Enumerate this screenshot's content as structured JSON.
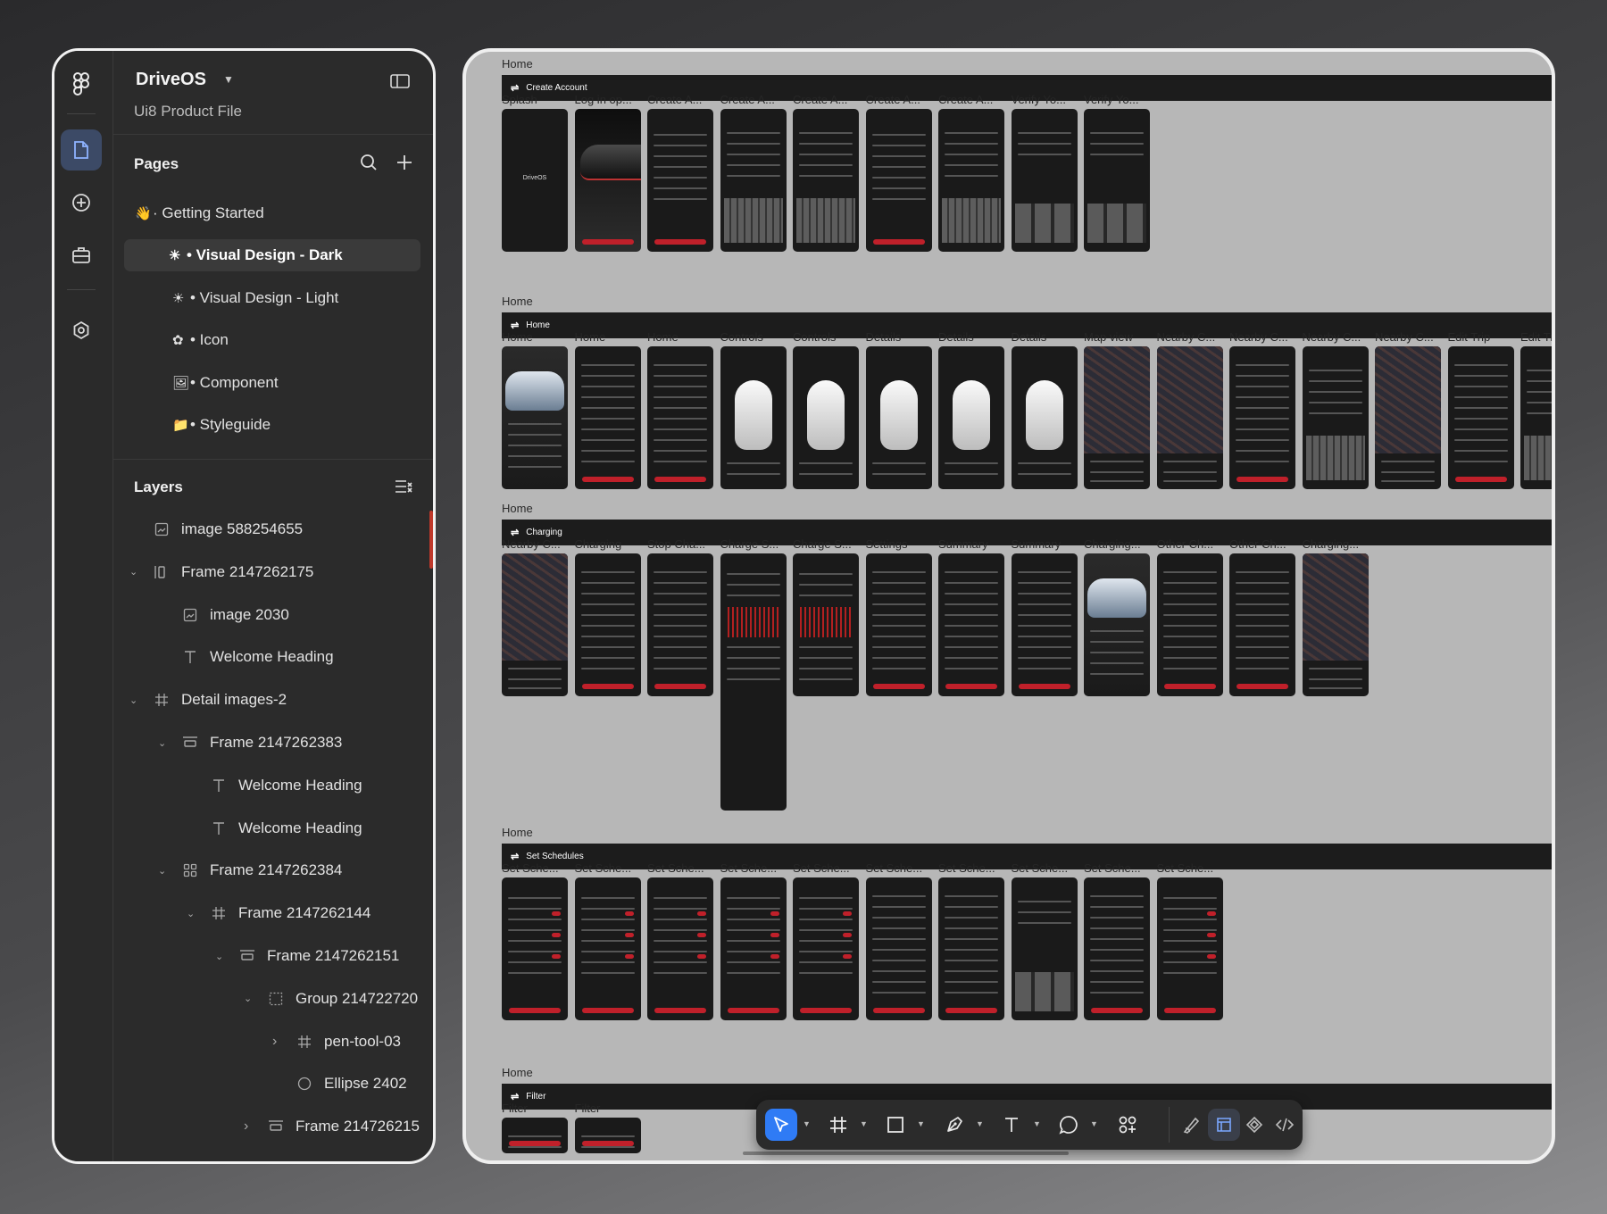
{
  "file": {
    "name": "DriveOS",
    "subtitle": "Ui8 Product File"
  },
  "pages": {
    "title": "Pages",
    "items": [
      {
        "emoji": "👋",
        "label": "· Getting Started",
        "active": false
      },
      {
        "emoji": "☀",
        "label": "• Visual Design - Dark",
        "active": true
      },
      {
        "emoji": "☀",
        "label": "• Visual Design - Light",
        "active": false
      },
      {
        "emoji": "✿",
        "label": "• Icon",
        "active": false
      },
      {
        "emoji": "🖼",
        "label": "• Component",
        "active": false
      },
      {
        "emoji": "📁",
        "label": "• Styleguide",
        "active": false
      }
    ]
  },
  "layers": {
    "title": "Layers",
    "items": [
      {
        "label": "image 588254655",
        "icon": "image-icon",
        "depth": 0,
        "chevron": ""
      },
      {
        "label": "Frame 2147262175",
        "icon": "frame-column-icon",
        "depth": 0,
        "chevron": "down"
      },
      {
        "label": "image 2030",
        "icon": "image-icon",
        "depth": 1,
        "chevron": ""
      },
      {
        "label": "Welcome Heading",
        "icon": "text-icon",
        "depth": 1,
        "chevron": ""
      },
      {
        "label": "Detail images-2",
        "icon": "frame-icon",
        "depth": 0,
        "chevron": "down"
      },
      {
        "label": "Frame 2147262383",
        "icon": "frame-row-icon",
        "depth": 1,
        "chevron": "down"
      },
      {
        "label": "Welcome Heading",
        "icon": "text-icon",
        "depth": 2,
        "chevron": ""
      },
      {
        "label": "Welcome Heading",
        "icon": "text-icon",
        "depth": 2,
        "chevron": ""
      },
      {
        "label": "Frame 2147262384",
        "icon": "frame-grid-icon",
        "depth": 1,
        "chevron": "down"
      },
      {
        "label": "Frame 2147262144",
        "icon": "frame-icon",
        "depth": 2,
        "chevron": "down"
      },
      {
        "label": "Frame 2147262151",
        "icon": "frame-row-icon",
        "depth": 3,
        "chevron": "down"
      },
      {
        "label": "Group 214722720",
        "icon": "group-icon",
        "depth": 4,
        "chevron": "down"
      },
      {
        "label": "pen-tool-03",
        "icon": "frame-icon",
        "depth": 5,
        "chevron": "right"
      },
      {
        "label": "Ellipse 2402",
        "icon": "ellipse-icon",
        "depth": 5,
        "chevron": ""
      },
      {
        "label": "Frame 214726215",
        "icon": "frame-row-icon",
        "depth": 4,
        "chevron": "right"
      }
    ]
  },
  "canvas": {
    "sections": [
      {
        "top_label": "Home",
        "bar": "Create Account",
        "screens": [
          "Splash",
          "Log in op...",
          "Create A...",
          "Create A...",
          "Create A...",
          "Create A...",
          "Create A...",
          "Verify Yo...",
          "Verify Yo..."
        ],
        "kinds": [
          "splash",
          "car-dark",
          "form",
          "keyboard",
          "keyboard",
          "form",
          "keyboard",
          "keypad",
          "keypad"
        ]
      },
      {
        "top_label": "Home",
        "bar": "Home",
        "screens": [
          "Home",
          "Home",
          "Home",
          "Controls",
          "Controls",
          "Details",
          "Details",
          "Details",
          "Map view",
          "Nearby C...",
          "Nearby C...",
          "Nearby C...",
          "Nearby C...",
          "Edit Trip",
          "Edit Tr"
        ],
        "kinds": [
          "car-side",
          "list",
          "list",
          "car-top",
          "car-top",
          "car-top",
          "car-top",
          "car-top",
          "map",
          "map",
          "list",
          "keyboard",
          "map",
          "list",
          "keyboard"
        ]
      },
      {
        "top_label": "Home",
        "bar": "Charging",
        "screens": [
          "Nearby C...",
          "Charging",
          "Stop Cha...",
          "Charge S...",
          "Charge S...",
          "Settings",
          "Summary",
          "Summary",
          "Charging...",
          "Other Ch...",
          "Other Ch...",
          "Charging..."
        ],
        "kinds": [
          "map",
          "list",
          "list",
          "chart",
          "chart",
          "list",
          "list",
          "list",
          "car-side",
          "list",
          "list",
          "map"
        ]
      },
      {
        "top_label": "Home",
        "bar": "Set Schedules",
        "screens": [
          "Set Sche...",
          "Set Sche...",
          "Set Sche...",
          "Set Sche...",
          "Set Sche...",
          "Set Sche...",
          "Set Sche...",
          "Set Sche...",
          "Set Sche...",
          "Set Sche..."
        ],
        "kinds": [
          "toggles",
          "toggles",
          "toggles",
          "toggles",
          "toggles",
          "list",
          "list",
          "keypad",
          "list",
          "toggles"
        ]
      },
      {
        "top_label": "Home",
        "bar": "Filter",
        "screens": [
          "Filter",
          "Filter"
        ],
        "kinds": [
          "list",
          "list"
        ]
      }
    ],
    "screen_text": {
      "splash_logo": "DriveOS",
      "form_heading": "Create Account",
      "verify_heading": "Verify Your Email"
    }
  },
  "toolbar": {
    "tools": [
      "move-icon",
      "frame-tool-icon",
      "rectangle-icon",
      "pen-icon",
      "text-tool-icon",
      "comment-icon",
      "actions-icon"
    ],
    "right_tools": [
      "draw-icon",
      "design-mode-icon",
      "prototype-icon",
      "dev-mode-icon"
    ]
  },
  "colors": {
    "accent": "#2f7bf5",
    "brand_red": "#c0202a",
    "panel_bg": "#2b2b2b",
    "canvas_bg": "#b7b7b7"
  }
}
